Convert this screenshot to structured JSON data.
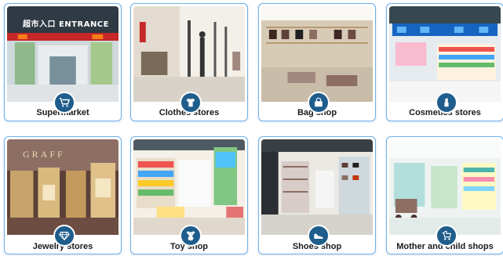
{
  "stores": [
    {
      "label": "Supermarket",
      "icon": "shopping-cart-icon",
      "sign": "超市入口 ENTRANCE"
    },
    {
      "label": "Clothes stores",
      "icon": "t-shirt-icon"
    },
    {
      "label": "Bag shop",
      "icon": "handbag-icon"
    },
    {
      "label": "Cosmetics stores",
      "icon": "lipstick-icon"
    },
    {
      "label": "Jewelry stores",
      "icon": "diamond-icon",
      "sign": "GRAFF"
    },
    {
      "label": "Toy shop",
      "icon": "teddy-bear-icon"
    },
    {
      "label": "Shoes shop",
      "icon": "shoe-icon"
    },
    {
      "label": "Mother and child shops",
      "icon": "baby-stroller-icon"
    }
  ],
  "colors": {
    "card_border": "#6fb1ea",
    "icon_badge": "#1f5d8c",
    "label_text": "#1a1a1a"
  }
}
